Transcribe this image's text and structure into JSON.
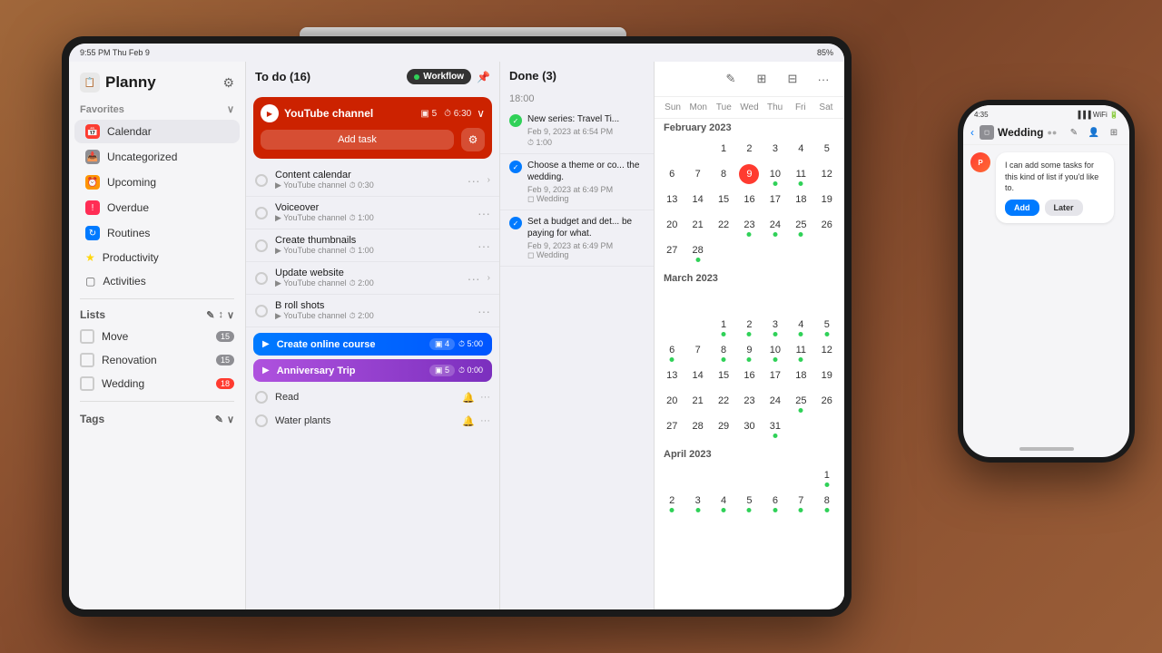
{
  "app": {
    "name": "Planny",
    "status_left": "9:55 PM  Thu Feb 9",
    "status_right": "85%"
  },
  "sidebar": {
    "favorites_label": "Favorites",
    "items": [
      {
        "id": "calendar",
        "label": "Calendar",
        "icon": "cal",
        "active": true
      },
      {
        "id": "uncategorized",
        "label": "Uncategorized",
        "icon": "inbox"
      },
      {
        "id": "upcoming",
        "label": "Upcoming",
        "icon": "clock"
      },
      {
        "id": "overdue",
        "label": "Overdue",
        "icon": "excl"
      },
      {
        "id": "routines",
        "label": "Routines",
        "icon": "repeat"
      },
      {
        "id": "productivity",
        "label": "Productivity",
        "icon": "star"
      },
      {
        "id": "activities",
        "label": "Activities",
        "icon": "square"
      }
    ],
    "lists_label": "Lists",
    "lists": [
      {
        "label": "Move",
        "badge": "15"
      },
      {
        "label": "Renovation",
        "badge": "15"
      },
      {
        "label": "Wedding",
        "badge": "18",
        "badge_red": true
      }
    ],
    "tags_label": "Tags"
  },
  "tasks": {
    "header": "To do (16)",
    "workflow_label": "Workflow",
    "groups": [
      {
        "title": "YouTube channel",
        "badge_count": "5",
        "time": "6:30",
        "color": "red"
      }
    ],
    "add_task": "Add task",
    "items": [
      {
        "name": "Content calendar",
        "sub": "YouTube channel",
        "time": "0:30"
      },
      {
        "name": "Voiceover",
        "sub": "YouTube channel",
        "time": "1:00"
      },
      {
        "name": "Create thumbnails",
        "sub": "YouTube channel",
        "time": "1:00"
      },
      {
        "name": "Update website",
        "sub": "YouTube channel",
        "time": "2:00"
      },
      {
        "name": "B roll shots",
        "sub": "YouTube channel",
        "time": "2:00"
      }
    ],
    "colored_tasks": [
      {
        "title": "Create online course",
        "color": "blue",
        "badge": "4",
        "time": "5:00"
      },
      {
        "title": "Anniversary Trip",
        "color": "purple",
        "badge": "5",
        "time": "0:00"
      }
    ],
    "plain_tasks": [
      {
        "name": "Read"
      },
      {
        "name": "Water plants"
      }
    ]
  },
  "done": {
    "header": "Done (3)",
    "time_label": "18:00",
    "items": [
      {
        "text": "New series: Travel Ti...",
        "date": "Feb 9, 2023 at 6:54 PM",
        "time": "1:00"
      },
      {
        "text": "Choose a theme or co... the wedding.",
        "date": "Feb 9, 2023 at 6:49 PM",
        "tag": "Wedding"
      },
      {
        "text": "Set a budget and det... be paying for what.",
        "date": "Feb 9, 2023 at 6:49 PM",
        "tag": "Wedding"
      }
    ]
  },
  "calendar": {
    "months": [
      {
        "label": "February 2023",
        "days": [
          "",
          "",
          "1",
          "2",
          "3",
          "4",
          "5",
          "6",
          "7",
          "8",
          "9",
          "10",
          "11",
          "12",
          "13",
          "14",
          "15",
          "16",
          "17",
          "18",
          "19",
          "20",
          "21",
          "22",
          "23",
          "24",
          "25",
          "26",
          "27",
          "28"
        ]
      },
      {
        "label": "March 2023",
        "days": [
          "",
          "",
          "",
          "",
          "",
          "",
          "",
          "",
          "",
          "1",
          "2",
          "3",
          "4",
          "5",
          "6",
          "7",
          "8",
          "9",
          "10",
          "11",
          "12",
          "13",
          "14",
          "15",
          "16",
          "17",
          "18",
          "19",
          "20",
          "21",
          "22",
          "23",
          "24",
          "25",
          "26",
          "27",
          "28",
          "29",
          "30",
          "31",
          ""
        ]
      },
      {
        "label": "April 2023",
        "days": [
          "",
          "",
          "",
          "",
          "",
          "",
          "1",
          "2",
          "3",
          "4",
          "5",
          "6",
          "7",
          "8"
        ]
      }
    ],
    "day_labels": [
      "Sun",
      "Mon",
      "Tue",
      "Wed",
      "Thu",
      "Fri",
      "Sat"
    ]
  },
  "iphone": {
    "status_time": "4:35",
    "nav_back": "‹",
    "nav_title": "Wedding",
    "chat_message": "I can add some tasks for this kind of list if you'd like to.",
    "btn_add": "Add",
    "btn_later": "Later"
  }
}
